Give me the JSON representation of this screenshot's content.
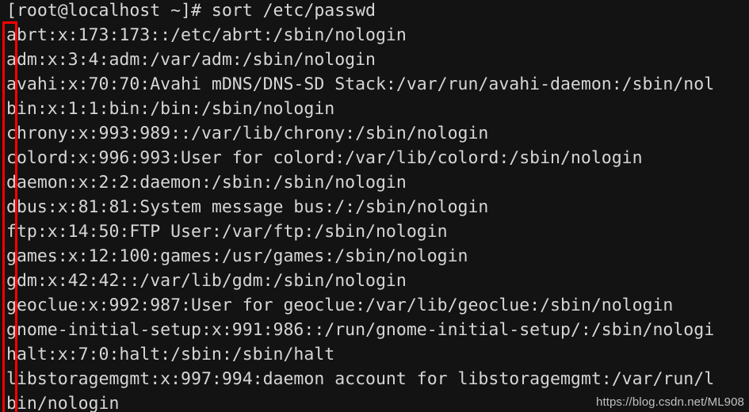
{
  "terminal": {
    "background_color": "#131313",
    "text_color": "#d6d6d6",
    "prompt": "[root@localhost ~]# sort /etc/passwd",
    "lines": [
      "[root@localhost ~]# sort /etc/passwd",
      "abrt:x:173:173::/etc/abrt:/sbin/nologin",
      "adm:x:3:4:adm:/var/adm:/sbin/nologin",
      "avahi:x:70:70:Avahi mDNS/DNS-SD Stack:/var/run/avahi-daemon:/sbin/nol",
      "bin:x:1:1:bin:/bin:/sbin/nologin",
      "chrony:x:993:989::/var/lib/chrony:/sbin/nologin",
      "colord:x:996:993:User for colord:/var/lib/colord:/sbin/nologin",
      "daemon:x:2:2:daemon:/sbin:/sbin/nologin",
      "dbus:x:81:81:System message bus:/:/sbin/nologin",
      "ftp:x:14:50:FTP User:/var/ftp:/sbin/nologin",
      "games:x:12:100:games:/usr/games:/sbin/nologin",
      "gdm:x:42:42::/var/lib/gdm:/sbin/nologin",
      "geoclue:x:992:987:User for geoclue:/var/lib/geoclue:/sbin/nologin",
      "gnome-initial-setup:x:991:986::/run/gnome-initial-setup/:/sbin/nologi",
      "halt:x:7:0:halt:/sbin:/sbin/halt",
      "libstoragemgmt:x:997:994:daemon account for libstoragemgmt:/var/run/l",
      "bin/nologin"
    ]
  },
  "annotation": {
    "type": "rectangle",
    "color": "#ff0000",
    "description": "red-box-around-first-character-column"
  },
  "watermark": {
    "text": "https://blog.csdn.net/ML908"
  }
}
